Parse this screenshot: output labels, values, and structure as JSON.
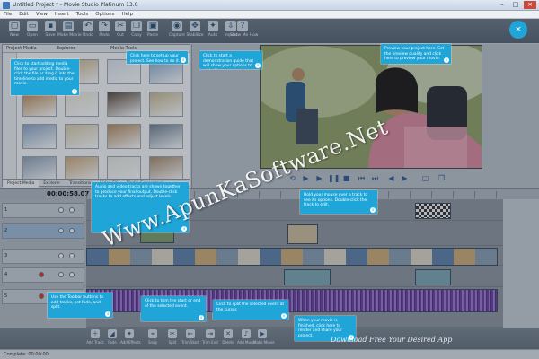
{
  "window": {
    "title": "Untitled Project * - Movie Studio Platinum 13.0",
    "menu": [
      "File",
      "Edit",
      "View",
      "Insert",
      "Tools",
      "Options",
      "Help"
    ]
  },
  "toolbar": {
    "items": [
      "New",
      "Open",
      "Save",
      "Make Movie",
      "Undo",
      "Redo",
      "Cut",
      "Copy",
      "Paste",
      "Capture",
      "Stabilize",
      "Auto",
      "Import",
      "Show Me How",
      "Music Maker"
    ]
  },
  "media": {
    "header_left": "Project Media",
    "header_mid": "Explorer",
    "header_right": "Media Tools",
    "tabs": [
      "Project Media",
      "Explorer",
      "Transitions",
      "Video FX",
      "Media Generators"
    ],
    "thumbs": [
      {
        "cap": "",
        "color": "#5a7fb0"
      },
      {
        "cap": "",
        "color": "#c9b28a"
      },
      {
        "cap": "",
        "color": "#d9dfe6"
      },
      {
        "cap": "",
        "color": "#8aa7c7"
      },
      {
        "cap": "",
        "color": "#b5854f"
      },
      {
        "cap": "",
        "color": "#e6e1d4"
      },
      {
        "cap": "",
        "color": "#5b4a3b"
      },
      {
        "cap": "",
        "color": "#c4b48f"
      },
      {
        "cap": "",
        "color": "#89a2c0"
      },
      {
        "cap": "",
        "color": "#d3c7a8"
      },
      {
        "cap": "",
        "color": "#b08a5d"
      },
      {
        "cap": "",
        "color": "#6f7f90"
      },
      {
        "cap": "",
        "color": "#8c9fb3"
      },
      {
        "cap": "",
        "color": "#c9a77a"
      },
      {
        "cap": "",
        "color": "#e5e3dc"
      },
      {
        "cap": "",
        "color": "#a68a6a"
      }
    ]
  },
  "preview": {
    "watermark": "Www.ApunKaSoftware.Net",
    "watermark_bottom": "Download Free Your Desired App"
  },
  "timeline": {
    "timecode": "00:00:58.07",
    "tracks": [
      "1",
      "2",
      "3",
      "4",
      "5"
    ]
  },
  "bottombar": {
    "items": [
      "Add Track",
      "Fade",
      "Add Effects",
      "Snap",
      "Split",
      "Trim Start",
      "Trim End",
      "Delete",
      "Add Music",
      "Make Movie"
    ]
  },
  "status": {
    "text": "Complete: 00:00:00"
  },
  "tips": {
    "t1": "Click to start adding media files to your project. Double-click the file or drag it into the timeline to add media to your movie.",
    "t2": "Click here to set up your project. See how to do it.",
    "t3": "Click to start a demonstration guide that will show your options to add effects.",
    "t4": "Preview your project here. Set the preview quality and click here to preview your movie.",
    "t5": "Audio and video tracks are shown together to produce your final output. Double-click tracks to add effects and adjust levels.",
    "t6": "Hold your mouse over a track to see its options. Double-click the track to edit.",
    "t7": "Use the Toolbar buttons to add tracks, set fade, and split.",
    "t8": "Click to trim the start or end of the selected event.",
    "t9": "Click to split the selected event at the cursor.",
    "t10": "When your movie is finished, click here to render and share your project."
  },
  "colors": {
    "tip_bg": "#1fa5d8",
    "toolbar": "#5f6b78",
    "audio_wave": "#7a4fb0",
    "video_track": "#9db7d4"
  }
}
